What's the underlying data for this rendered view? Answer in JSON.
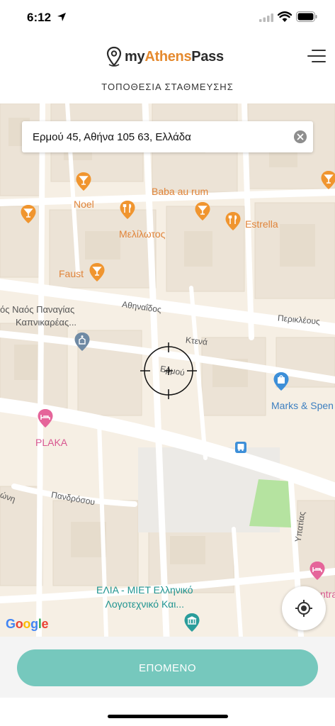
{
  "status": {
    "time": "6:12"
  },
  "header": {
    "logo": {
      "my": "my",
      "athens": "Athens",
      "pass": "Pass"
    },
    "subtitle": "ΤΟΠΟΘΕΣΙΑ ΣΤΑΘΜΕΥΣΗΣ"
  },
  "search": {
    "value": "Ερμού 45, Αθήνα 105 63, Ελλάδα"
  },
  "map": {
    "pois": {
      "noel": "Noel",
      "baba_au_rum": "Baba au rum",
      "melilotos": "Μελίλωτος",
      "estrella": "Estrella",
      "faust": "Faust",
      "church_line1": "ός Ναός Παναγίας",
      "church_line2": "Καπνικαρέας...",
      "marks": "Marks & Spen",
      "plaka": "PLAKA",
      "elia_line1": "ΕΛΙΑ - ΜΙΕΤ Ελληνικό",
      "elia_line2": "Λογοτεχνικό Και...",
      "ntra": "ntra"
    },
    "streets": {
      "athinaidos": "Αθηναΐδος",
      "periklous": "Περικλέους",
      "ktena": "Κτενά",
      "ermou": "Ερμού",
      "pandrosou": "Πανδρόσου",
      "ypatias": "Υπατίας",
      "onos": "ώνη"
    },
    "google": {
      "g1": "G",
      "o1": "o",
      "o2": "o",
      "g2": "g",
      "l": "l",
      "e": "e"
    }
  },
  "footer": {
    "next_label": "ΕΠΟΜΕΝΟ"
  },
  "colors": {
    "accent_orange": "#e58a2f",
    "button_teal": "#76c8bd",
    "poi_orange": "#f0952f",
    "poi_pink": "#e5659a",
    "poi_teal": "#2a9d9b",
    "poi_blue": "#3d8fd8",
    "poi_gray_blue": "#6f8aa4"
  }
}
